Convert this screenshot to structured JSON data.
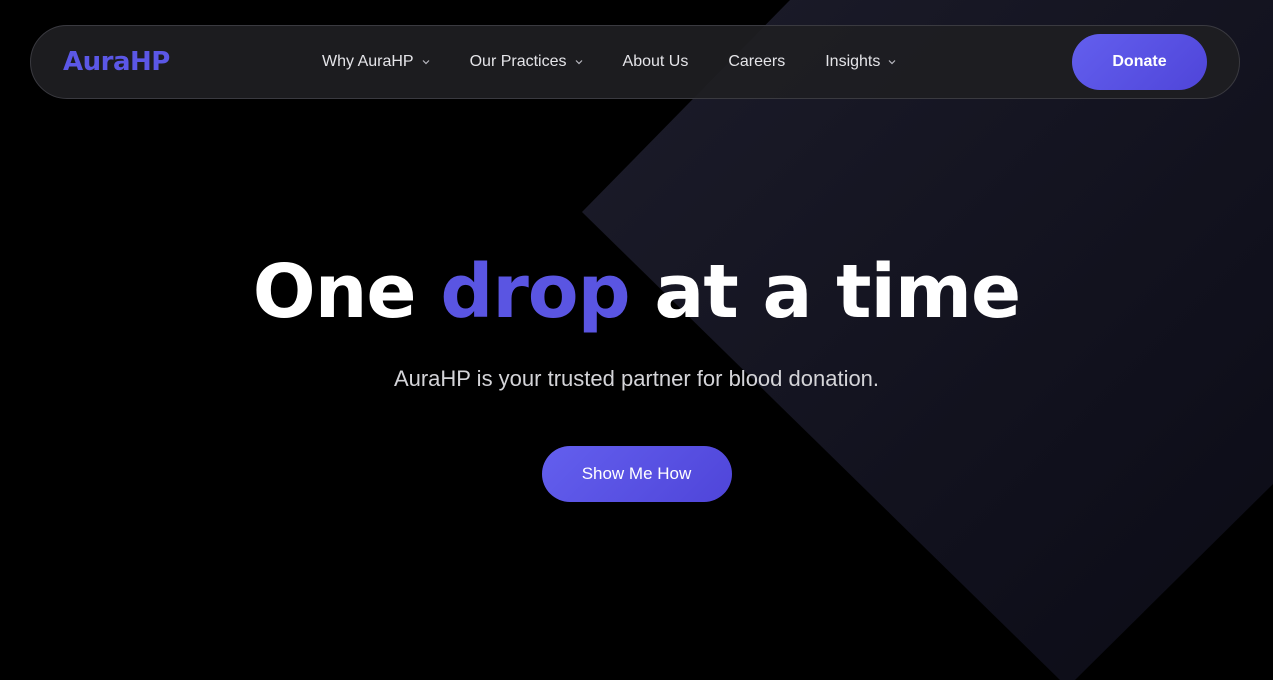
{
  "brand": {
    "name": "AuraHP",
    "accent_color": "#5b57e6"
  },
  "nav": {
    "items": [
      {
        "label": "Why AuraHP",
        "has_dropdown": true
      },
      {
        "label": "Our Practices",
        "has_dropdown": true
      },
      {
        "label": "About Us",
        "has_dropdown": false
      },
      {
        "label": "Careers",
        "has_dropdown": false
      },
      {
        "label": "Insights",
        "has_dropdown": true
      }
    ],
    "donate_label": "Donate",
    "chevron_icon": "chevron-down-icon"
  },
  "hero": {
    "headline_before": "One ",
    "headline_accent": "drop",
    "headline_after": " at a time",
    "subtitle": "AuraHP is your trusted partner for blood donation.",
    "cta_label": "Show Me How"
  },
  "colors": {
    "background": "#000000",
    "navbar_bg": "#1e1e22",
    "button_gradient_start": "#635fee",
    "button_gradient_end": "#4f45d9",
    "headline": "#ffffff",
    "subtitle": "#d4d4d8"
  }
}
